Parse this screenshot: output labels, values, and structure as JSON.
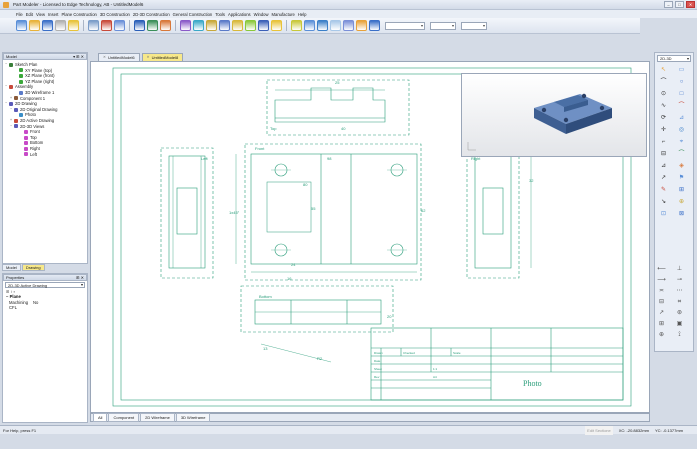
{
  "window": {
    "title": "Part Modeler - Licensed to Edge Technology, AB - UntitledModel6",
    "controls": [
      "–",
      "□",
      "✕"
    ]
  },
  "menu": [
    "File",
    "Edit",
    "View",
    "Insert",
    "Plane Construction",
    "3D Construction",
    "2D-3D Construction",
    "General Construction",
    "Tools",
    "Applications",
    "Window",
    "Manufacture",
    "Help"
  ],
  "toolbar": {
    "icon_colors": [
      "#5a8fd8",
      "#e8b23a",
      "#3a6fc8",
      "#b0b0b0",
      "#e8c33a",
      "#7a9cc8",
      "#c84a3a",
      "#6a8fd8",
      "#2a5fb8",
      "#3a8f5a",
      "#d8783a",
      "#8a5ac8",
      "#3aa8c8",
      "#c8a83a",
      "#5a7ac8",
      "#d8b83a",
      "#8ac83a",
      "#3a5fb8",
      "#e8c33a",
      "#c8c83a",
      "#5a8fd8",
      "#3a7fc8",
      "#a8c8e8",
      "#7a8fd8",
      "#e8a23a",
      "#3a6fc8"
    ],
    "dropdowns": [
      "",
      "",
      ""
    ]
  },
  "model_panel": {
    "title": "Model",
    "tree": [
      {
        "label": "Sketch Plan",
        "indent": 0,
        "color": "#3a7f3a",
        "exp": "−"
      },
      {
        "label": "XY Plane (top)",
        "indent": 2,
        "color": "#3aa83a",
        "exp": ""
      },
      {
        "label": "XZ Plane (front)",
        "indent": 2,
        "color": "#3aa83a",
        "exp": ""
      },
      {
        "label": "YZ Plane (right)",
        "indent": 2,
        "color": "#3aa83a",
        "exp": ""
      },
      {
        "label": "Assembly",
        "indent": 0,
        "color": "#c84a3a",
        "exp": "−"
      },
      {
        "label": "3D Wireframe 1",
        "indent": 2,
        "color": "#5a7ac8",
        "exp": ""
      },
      {
        "label": "Component 1",
        "indent": 1,
        "color": "#8a5a3a",
        "exp": "+"
      },
      {
        "label": "2D Drawing",
        "indent": 0,
        "color": "#5a5ab8",
        "exp": "−"
      },
      {
        "label": "2D Original Drawing",
        "indent": 1,
        "color": "#5a5ab8",
        "exp": "−"
      },
      {
        "label": "Photo",
        "indent": 2,
        "color": "#3a8fc8",
        "exp": ""
      },
      {
        "label": "2D Active Drawing",
        "indent": 1,
        "color": "#c84a3a",
        "exp": "+"
      },
      {
        "label": "2D-3D Views",
        "indent": 1,
        "color": "#5a5ab8",
        "exp": "−"
      },
      {
        "label": "Front",
        "indent": 3,
        "color": "#c84ac8",
        "exp": ""
      },
      {
        "label": "Top",
        "indent": 3,
        "color": "#c84ac8",
        "exp": ""
      },
      {
        "label": "Bottom",
        "indent": 3,
        "color": "#c84ac8",
        "exp": ""
      },
      {
        "label": "Right",
        "indent": 3,
        "color": "#c84ac8",
        "exp": ""
      },
      {
        "label": "Left",
        "indent": 3,
        "color": "#c84ac8",
        "exp": ""
      }
    ],
    "tabs": [
      "Model",
      "Drawing"
    ],
    "active_tab": "Drawing"
  },
  "properties": {
    "title": "Properties",
    "selector": "2D-3D Active Drawing",
    "group": "Plane",
    "rows": [
      {
        "key": "Machining CFL",
        "value": "No"
      }
    ]
  },
  "document_tabs": [
    {
      "label": "UntitledModel6",
      "active": false
    },
    {
      "label": "UntitledModel8",
      "active": true
    }
  ],
  "drawing": {
    "view_labels": [
      "Top",
      "Front",
      "Left",
      "Right",
      "Bottom"
    ],
    "dim_labels": [
      "25",
      "40",
      "98",
      "80",
      "55",
      "62",
      "32",
      "24",
      "1x45°",
      "16",
      "20",
      "13",
      "R2"
    ],
    "title_block": {
      "cells": [
        "Drawn",
        "Checked",
        "Scale",
        "Date",
        "Sheet",
        "1:1",
        "Rev",
        "A4"
      ],
      "name": "Photo"
    }
  },
  "view_tabs": [
    "All",
    "Component",
    "2D Wireframe",
    "3D Wireframe"
  ],
  "active_view_tab": "All",
  "status": {
    "help": "For Help, press F1",
    "frame": "Edit Sectione",
    "x": "XC: -20.8832mm",
    "y": "YC: -0.1377mm"
  },
  "right_panel": {
    "selector": "2D-3D",
    "tools": [
      "↖",
      "▭",
      "⌒",
      "○",
      "⊙",
      "□",
      "∿",
      "⌒",
      "⟳",
      "⊿",
      "✛",
      "◎",
      "⌐",
      "⌖",
      "⊟",
      "⌒",
      "⊿",
      "◈",
      "↗",
      "⚑",
      "✎",
      "⊞",
      "↘",
      "⊕",
      "⊡",
      "⊠"
    ],
    "tool_colors": [
      "#e8a23a",
      "#5a8fd8",
      "#333",
      "#3a6fc8",
      "#333",
      "#3a6fc8",
      "#333",
      "#c84a3a",
      "#333",
      "#5a8fd8",
      "#333",
      "#3a7fc8",
      "#333",
      "#5a8fd8",
      "#333",
      "#3a8f5a",
      "#333",
      "#d8783a",
      "#333",
      "#5a8fd8",
      "#c84a3a",
      "#3a6fc8",
      "#333",
      "#c8a83a",
      "#5a8fd8",
      "#3a6fc8"
    ],
    "lower_tools": [
      "⟵",
      "⊥",
      "⟶",
      "⊸",
      "≍",
      "⋯",
      "⊟",
      "⌗",
      "↗",
      "⊛",
      "⊞",
      "▣",
      "⊕",
      "⟟"
    ]
  },
  "preview": {
    "part_color": "#4a6fa5"
  }
}
